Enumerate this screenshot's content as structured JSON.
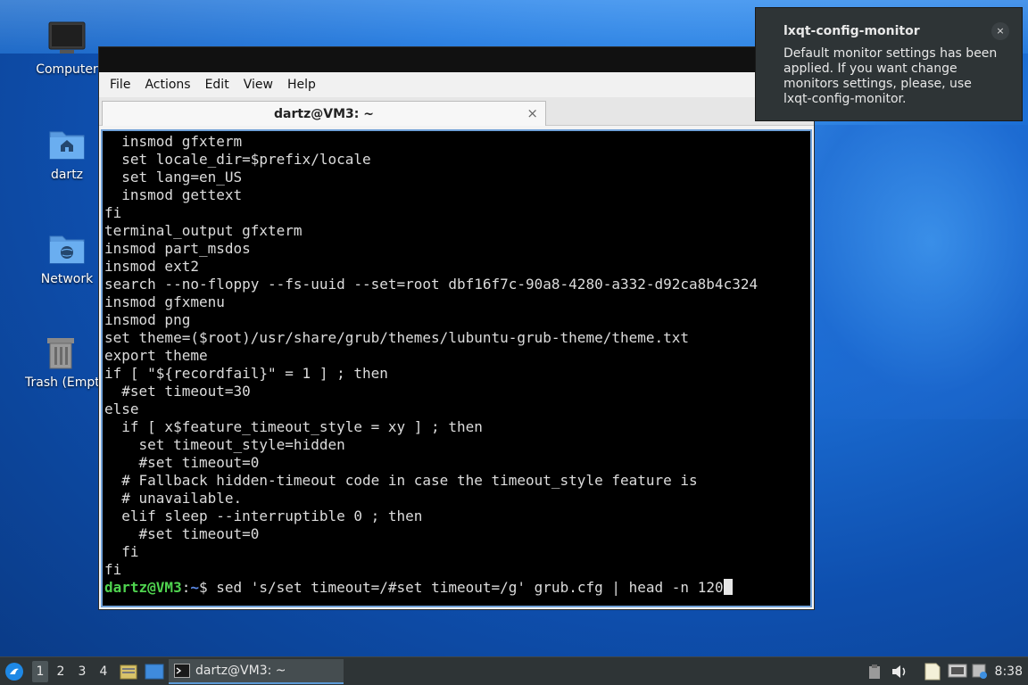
{
  "desktop": {
    "icons": [
      {
        "label": "Computer"
      },
      {
        "label": "dartz"
      },
      {
        "label": "Network"
      },
      {
        "label": "Trash (Empty)"
      }
    ]
  },
  "terminal": {
    "menu": [
      "File",
      "Actions",
      "Edit",
      "View",
      "Help"
    ],
    "tab_title": "dartz@VM3: ~",
    "tab_close": "×",
    "lines": [
      "  insmod gfxterm",
      "  set locale_dir=$prefix/locale",
      "  set lang=en_US",
      "  insmod gettext",
      "fi",
      "terminal_output gfxterm",
      "insmod part_msdos",
      "insmod ext2",
      "search --no-floppy --fs-uuid --set=root dbf16f7c-90a8-4280-a332-d92ca8b4c324",
      "insmod gfxmenu",
      "insmod png",
      "set theme=($root)/usr/share/grub/themes/lubuntu-grub-theme/theme.txt",
      "export theme",
      "if [ \"${recordfail}\" = 1 ] ; then",
      "  #set timeout=30",
      "else",
      "  if [ x$feature_timeout_style = xy ] ; then",
      "    set timeout_style=hidden",
      "    #set timeout=0",
      "  # Fallback hidden-timeout code in case the timeout_style feature is",
      "  # unavailable.",
      "  elif sleep --interruptible 0 ; then",
      "    #set timeout=0",
      "  fi",
      "fi"
    ],
    "prompt": {
      "user": "dartz@VM3",
      "sep": ":",
      "path": "~",
      "symbol": "$ ",
      "command": "sed 's/set timeout=/#set timeout=/g' grub.cfg | head -n 120"
    }
  },
  "notification": {
    "title": "lxqt-config-monitor",
    "body": "Default monitor settings has been applied. If you want change monitors settings, please, use lxqt-config-monitor.",
    "close": "×"
  },
  "taskbar": {
    "workspaces": [
      "1",
      "2",
      "3",
      "4"
    ],
    "active_workspace": "1",
    "task_label": "dartz@VM3: ~",
    "clock": "8:38"
  },
  "colors": {
    "prompt_user": "#4fd34f",
    "prompt_path": "#5b8ae8",
    "panel": "#2e3436"
  }
}
